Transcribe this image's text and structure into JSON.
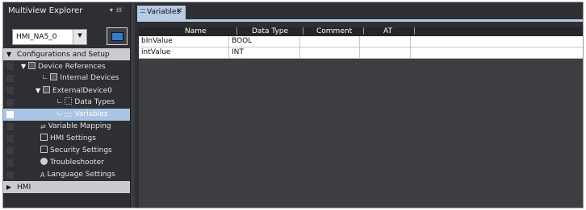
{
  "explorer": {
    "title": "Multiview Explorer",
    "device": "HMI_NA5_0",
    "tree": [
      {
        "label": "Configurations and Setup",
        "icon": "collapse-triangle-icon",
        "state": "expanded"
      },
      {
        "label": "Device References",
        "icon": "device-references-icon",
        "state": "expanded"
      },
      {
        "label": "Internal Devices",
        "icon": "internal-device-icon"
      },
      {
        "label": "ExternalDevice0",
        "icon": "external-device-icon",
        "state": "expanded"
      },
      {
        "label": "Data Types",
        "icon": "data-types-icon"
      },
      {
        "label": "Variables",
        "icon": "variables-icon",
        "selected": true
      },
      {
        "label": "Variable Mapping",
        "icon": "variable-mapping-icon"
      },
      {
        "label": "HMI Settings",
        "icon": "hmi-settings-icon"
      },
      {
        "label": "Security Settings",
        "icon": "security-icon"
      },
      {
        "label": "Troubleshooter",
        "icon": "troubleshooter-icon"
      },
      {
        "label": "Language Settings",
        "icon": "language-icon"
      },
      {
        "label": "HMI",
        "icon": "expand-triangle-icon",
        "state": "collapsed"
      }
    ]
  },
  "editor": {
    "tab": "Variables",
    "columns": [
      "Name",
      "Data Type",
      "Comment",
      "AT"
    ],
    "rows": [
      {
        "name": "bInValue",
        "type": "BOOL",
        "comment": "",
        "at": ""
      },
      {
        "name": "intValue",
        "type": "INT",
        "comment": "",
        "at": ""
      }
    ]
  },
  "colors": {
    "background": "#2d2f33",
    "selection": "#a9c4e4",
    "tab": "#b8cbe2"
  }
}
